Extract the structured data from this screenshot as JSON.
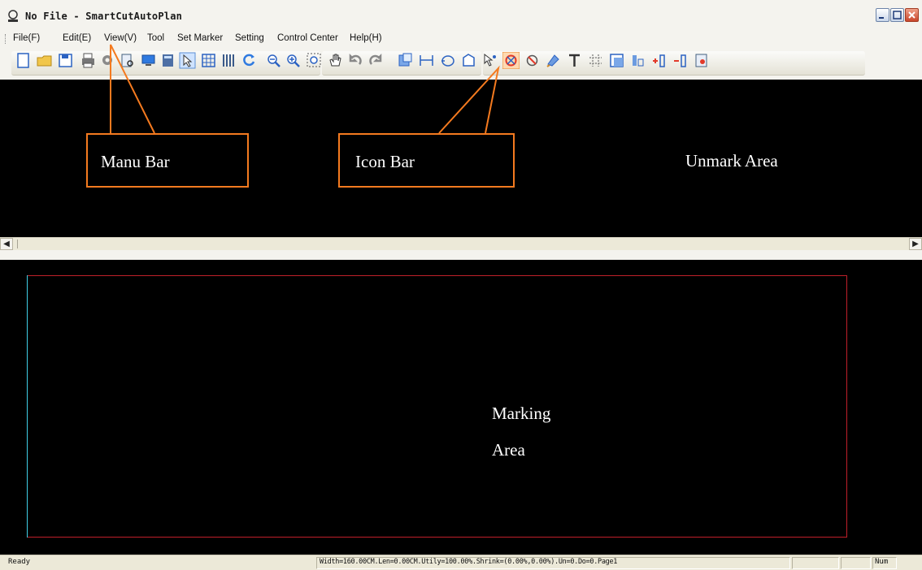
{
  "window": {
    "title": "No File - SmartCutAutoPlan"
  },
  "menu": {
    "items": [
      "File(F)",
      "Edit(E)",
      "View(V)",
      "Tool",
      "Set Marker",
      "Setting",
      "Control Center",
      "Help(H)"
    ]
  },
  "toolbar": {
    "icons": [
      "new-file-icon",
      "open-folder-icon",
      "save-icon",
      "print-icon",
      "settings-gear-icon",
      "document-preview-icon",
      "monitor-icon",
      "calculator-icon",
      "pointer-select-icon",
      "grid-icon",
      "columns-icon",
      "refresh-icon",
      "zoom-out-icon",
      "zoom-in-icon",
      "zoom-window-icon",
      "hand-pan-icon",
      "undo-icon",
      "redo-icon",
      "piece-icon",
      "measure-icon",
      "loop-icon",
      "shape-icon",
      "pick-icon",
      "no-overlap-icon",
      "rotate-off-icon",
      "paint-icon",
      "text-icon",
      "crosshair-grid-icon",
      "fit-window-icon",
      "align-icon",
      "add-column-icon",
      "remove-column-icon",
      "mark-settings-icon"
    ]
  },
  "annotations": {
    "menu_bar": "Manu Bar",
    "icon_bar": "Icon Bar",
    "unmark_area": "Unmark Area",
    "marking_area_line1": "Marking",
    "marking_area_line2": "Area"
  },
  "colors": {
    "canvas": "#000000",
    "callout": "#f47a1f",
    "marker_frame": "#c0202a",
    "marker_edge": "#3fd0e8"
  },
  "statusbar": {
    "ready": "Ready",
    "info": "Width=160.00CM.Len=0.00CM.Utily=100.00%.Shrink=(0.00%,0.00%).Un=0.Do=0.Page1",
    "num": "Num"
  }
}
